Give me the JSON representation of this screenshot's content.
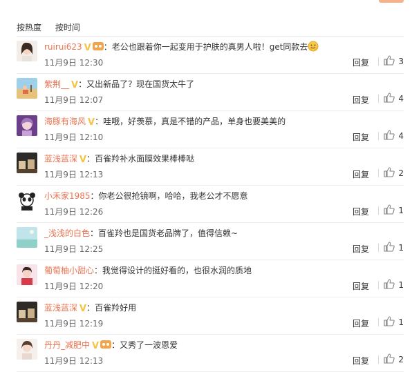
{
  "sort": {
    "hot": "按热度",
    "time": "按时间"
  },
  "labels": {
    "reply": "回复"
  },
  "colors": {
    "username": "#eb7350",
    "badge": "#f6c343"
  },
  "comments": [
    {
      "user": "ruirui623",
      "badges": [
        "v",
        "vip"
      ],
      "text": "：老公也跟着你一起变用于护肤的真男人啦！get同款去",
      "emoji": "hug-emoji",
      "time": "11月9日 12:30",
      "likes": "3",
      "avatar": "girl-portrait"
    },
    {
      "user": "紫荆__",
      "badges": [
        "v"
      ],
      "text": "：又出新品了？现在国货太牛了",
      "time": "11月9日 12:07",
      "likes": "4",
      "avatar": "beach-scene"
    },
    {
      "user": "海豚有海风",
      "badges": [
        "v"
      ],
      "text": "：哇哦，好羡慕，真是不错的产品，单身也要美美的",
      "time": "11月9日 12:10",
      "likes": "4",
      "avatar": "purple-girl"
    },
    {
      "user": "蓝浅蓝深",
      "badges": [
        "v"
      ],
      "text": "：百雀羚补水面膜效果棒棒哒",
      "time": "11月9日 12:13",
      "likes": "2",
      "avatar": "cafe-cups"
    },
    {
      "user": "小禾家1985",
      "badges": [],
      "text": "：你老公很抢镜啊，哈哈，我老公才不愿意",
      "time": "11月9日 12:26",
      "likes": "1",
      "avatar": "panda"
    },
    {
      "user": "_浅浅的白色",
      "badges": [],
      "text": "：百雀羚也是国货老品牌了，值得信赖~",
      "time": "11月9日 12:25",
      "likes": "1",
      "avatar": "sea-sky"
    },
    {
      "user": "葡萄柚小甜心",
      "badges": [],
      "text": "：我觉得设计的挺好看的，也很水润的质地",
      "time": "11月9日 12:20",
      "likes": "1",
      "avatar": "red-girl"
    },
    {
      "user": "蓝浅蓝深",
      "badges": [
        "v"
      ],
      "text": "：百雀羚好用",
      "time": "11月9日 12:19",
      "likes": "1",
      "avatar": "cafe-cups"
    },
    {
      "user": "丹丹_减肥中",
      "badges": [
        "v",
        "vip"
      ],
      "text": "：又秀了一波恩爱",
      "time": "11月9日 12:13",
      "likes": "2",
      "avatar": "girl-selfie"
    }
  ]
}
